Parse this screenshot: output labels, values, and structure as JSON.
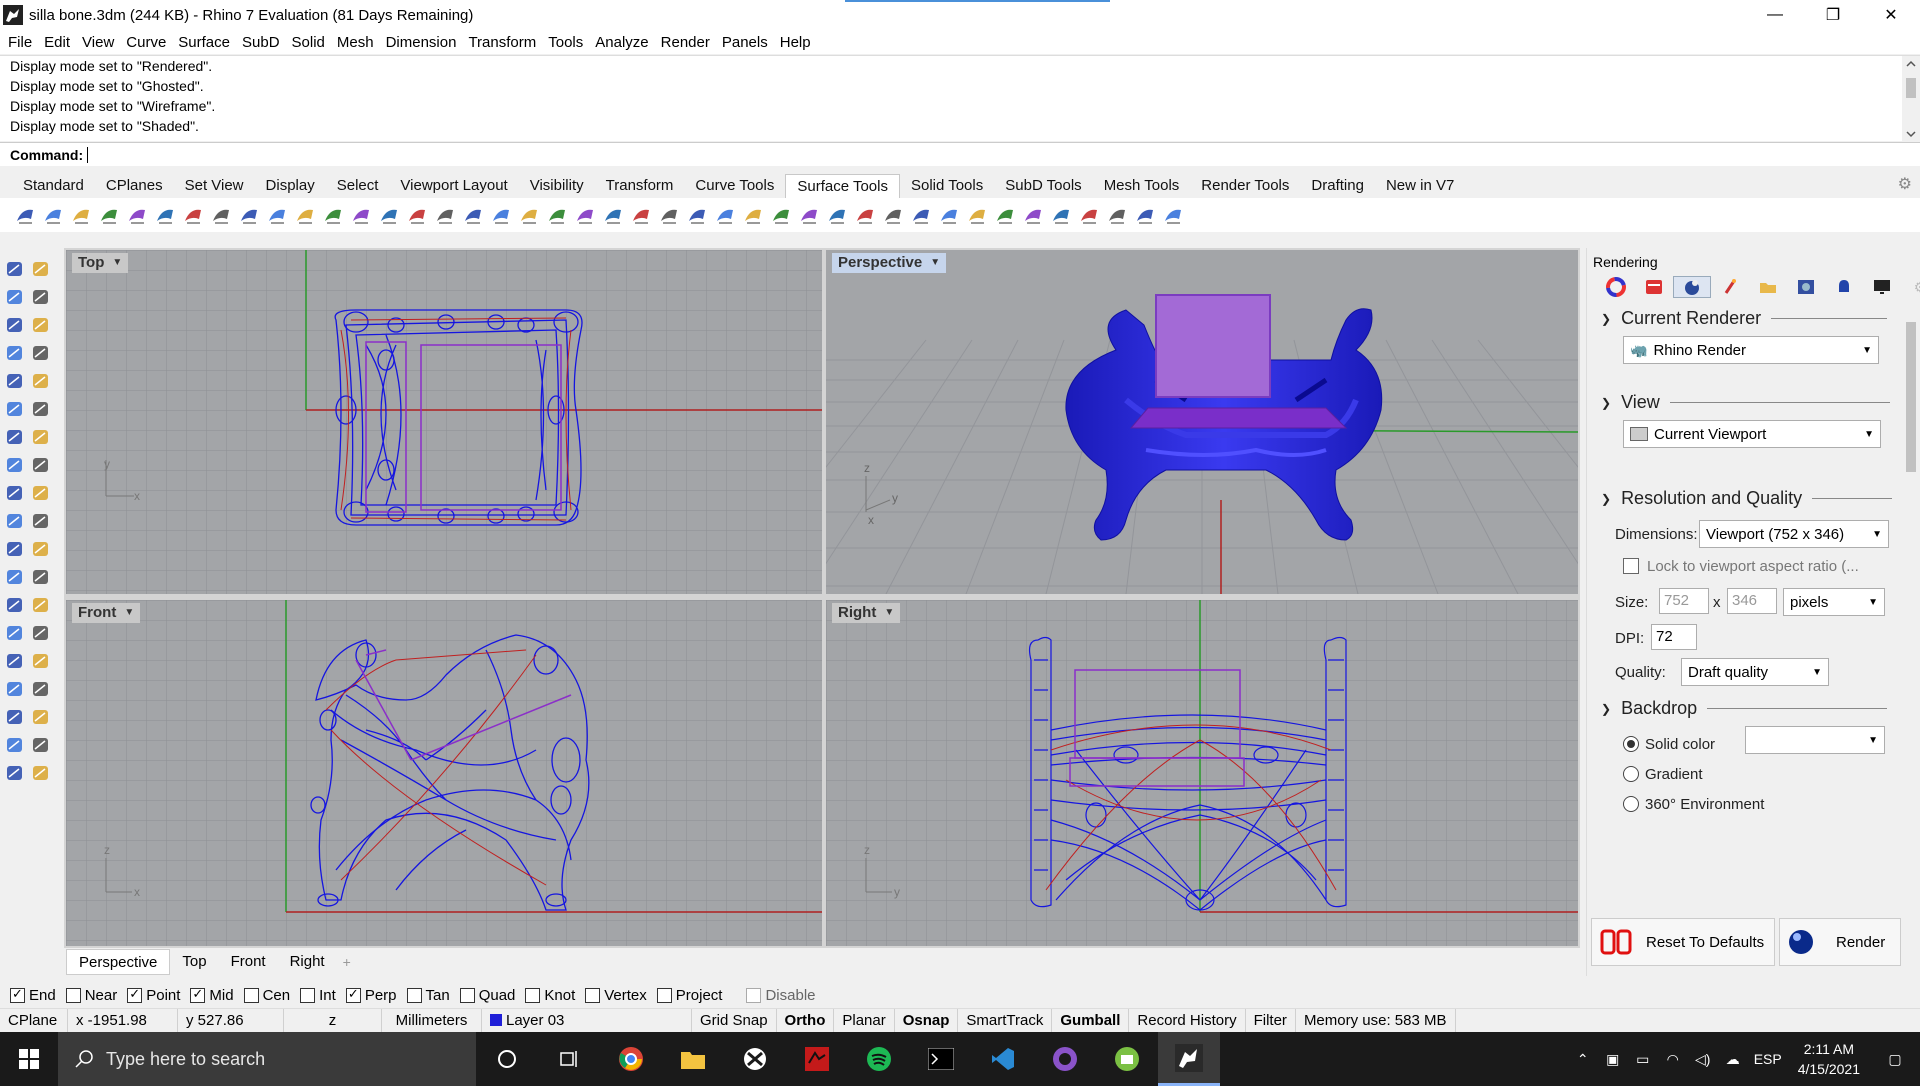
{
  "window": {
    "title": "silla bone.3dm (244 KB) - Rhino 7 Evaluation (81 Days Remaining)",
    "controls": [
      "—",
      "❐",
      "✕"
    ]
  },
  "menubar": [
    "File",
    "Edit",
    "View",
    "Curve",
    "Surface",
    "SubD",
    "Solid",
    "Mesh",
    "Dimension",
    "Transform",
    "Tools",
    "Analyze",
    "Render",
    "Panels",
    "Help"
  ],
  "history": {
    "lines": [
      "Display mode set to \"Rendered\".",
      "Display mode set to \"Ghosted\".",
      "Display mode set to \"Wireframe\".",
      "Display mode set to \"Shaded\"."
    ],
    "command_label": "Command:"
  },
  "toolbar_tabs": [
    "Standard",
    "CPlanes",
    "Set View",
    "Display",
    "Select",
    "Viewport Layout",
    "Visibility",
    "Transform",
    "Curve Tools",
    "Surface Tools",
    "Solid Tools",
    "SubD Tools",
    "Mesh Tools",
    "Render Tools",
    "Drafting",
    "New in V7"
  ],
  "toolbar_active_tab": "Surface Tools",
  "viewports": {
    "top": {
      "label": "Top"
    },
    "perspective": {
      "label": "Perspective"
    },
    "front": {
      "label": "Front"
    },
    "right": {
      "label": "Right"
    }
  },
  "axis_labels": {
    "x": "x",
    "y": "y",
    "z": "z"
  },
  "viewport_tabs": [
    "Perspective",
    "Top",
    "Front",
    "Right"
  ],
  "viewport_tabs_add": "+",
  "panel": {
    "title": "Rendering",
    "current_renderer": {
      "heading": "Current Renderer",
      "value": "Rhino Render"
    },
    "view": {
      "heading": "View",
      "value": "Current Viewport"
    },
    "resolution": {
      "heading": "Resolution and Quality",
      "dimensions_label": "Dimensions:",
      "dimensions_value": "Viewport (752 x 346)",
      "lock_label": "Lock to viewport aspect ratio (...",
      "size_label": "Size:",
      "width": "752",
      "times": "x",
      "height": "346",
      "unit": "pixels",
      "dpi_label": "DPI:",
      "dpi": "72",
      "quality_label": "Quality:",
      "quality_value": "Draft quality"
    },
    "backdrop": {
      "heading": "Backdrop",
      "options": [
        "Solid color",
        "Gradient",
        "360° Environment"
      ],
      "selected": "Solid color"
    },
    "reset_button": "Reset To Defaults",
    "render_button": "Render"
  },
  "osnaps": [
    {
      "label": "End",
      "checked": true
    },
    {
      "label": "Near",
      "checked": false
    },
    {
      "label": "Point",
      "checked": true
    },
    {
      "label": "Mid",
      "checked": true
    },
    {
      "label": "Cen",
      "checked": false
    },
    {
      "label": "Int",
      "checked": false
    },
    {
      "label": "Perp",
      "checked": true
    },
    {
      "label": "Tan",
      "checked": false
    },
    {
      "label": "Quad",
      "checked": false
    },
    {
      "label": "Knot",
      "checked": false
    },
    {
      "label": "Vertex",
      "checked": false
    },
    {
      "label": "Project",
      "checked": false
    },
    {
      "label": "Disable",
      "checked": false
    }
  ],
  "status": {
    "cplane": "CPlane",
    "x": "x -1951.98",
    "y": "y 527.86",
    "z": "z",
    "units": "Millimeters",
    "layer": "Layer 03",
    "layer_color": "#1f1fd8",
    "toggles": [
      {
        "label": "Grid Snap",
        "on": false
      },
      {
        "label": "Ortho",
        "on": true
      },
      {
        "label": "Planar",
        "on": false
      },
      {
        "label": "Osnap",
        "on": true
      },
      {
        "label": "SmartTrack",
        "on": false
      },
      {
        "label": "Gumball",
        "on": true
      },
      {
        "label": "Record History",
        "on": false
      },
      {
        "label": "Filter",
        "on": false
      }
    ],
    "memory": "Memory use: 583 MB"
  },
  "taskbar": {
    "search_placeholder": "Type here to search",
    "time": "2:11 AM",
    "date": "4/15/2021",
    "lang": "ESP"
  },
  "colors": {
    "viewport_bg": "#a3a5a8",
    "wire": "#1010e0",
    "curve_red": "#c02020",
    "purple": "#8b2fc9",
    "solid_blue": "#2a2ae0"
  }
}
